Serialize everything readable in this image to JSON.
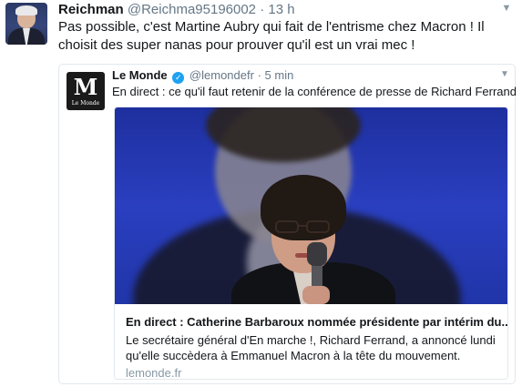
{
  "tweet": {
    "author_name": "Reichman",
    "author_handle": "@Reichma95196002",
    "separator": "·",
    "time": "13 h",
    "text": "Pas possible, c'est Martine Aubry qui fait de l'entrisme chez Macron ! Il  choisit des super nanas pour prouver qu'il est un vrai mec !",
    "menu_icon": "chevron-down-icon"
  },
  "quoted": {
    "author_name": "Le Monde",
    "logo_letter": "M",
    "logo_caption": "Le Monde",
    "author_handle": "@lemondefr",
    "separator": "·",
    "time": "5 min",
    "text": "En direct : ce qu'il faut retenir de la conférence de presse de Richard Ferrand",
    "verified_icon": "verified-badge-icon",
    "verified_mark": "✓",
    "menu_icon": "chevron-down-icon"
  },
  "card": {
    "title": "En direct : Catherine Barbaroux nommée présidente par intérim du..",
    "description": "Le secrétaire général d'En marche !, Richard Ferrand, a annoncé lundi qu'elle succèdera à Emmanuel Macron à la tête du mouvement.",
    "domain": "lemonde.fr"
  },
  "colors": {
    "text": "#14171a",
    "secondary": "#657786",
    "border": "#e1e8ed",
    "verified": "#1da1f2",
    "photo_background": "#2a3fc0"
  }
}
